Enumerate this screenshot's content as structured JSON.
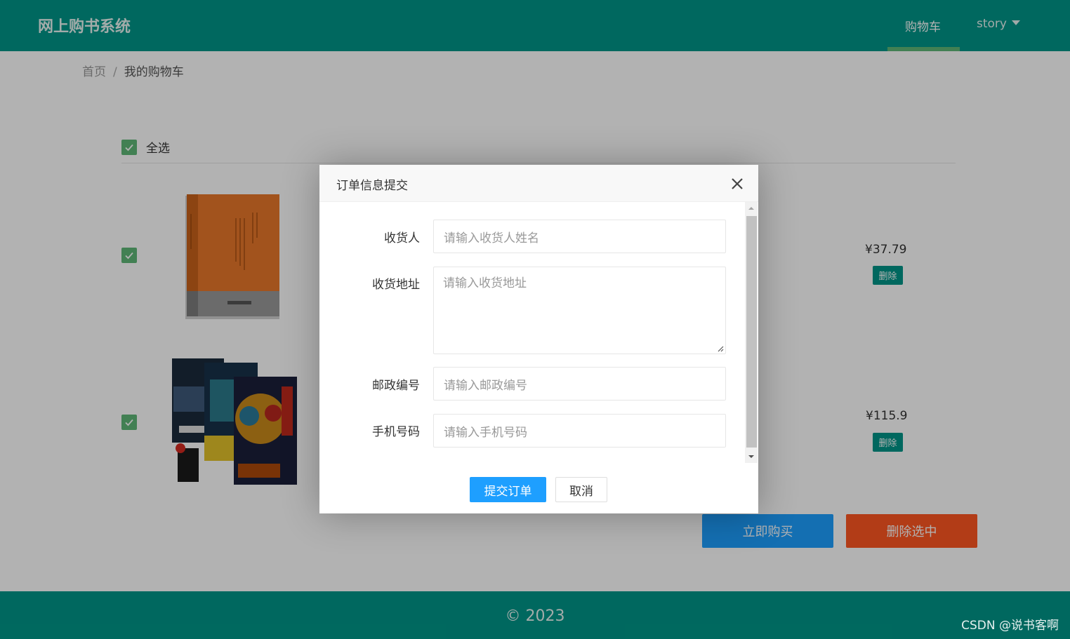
{
  "header": {
    "logo": "网上购书系统",
    "nav_cart": "购物车",
    "nav_user": "story"
  },
  "breadcrumb": {
    "home": "首页",
    "separator": "/",
    "current": "我的购物车"
  },
  "cart": {
    "select_all_label": "全选",
    "items": [
      {
        "price": "¥37.79",
        "delete_label": "删除",
        "checked": true
      },
      {
        "price": "¥115.9",
        "delete_label": "删除",
        "checked": true
      }
    ],
    "buy_label": "立即购买",
    "delete_selected_label": "删除选中"
  },
  "footer": {
    "text": "© 2023"
  },
  "watermark": "CSDN @说书客啊",
  "dialog": {
    "title": "订单信息提交",
    "fields": [
      {
        "label": "收货人",
        "placeholder": "请输入收货人姓名"
      },
      {
        "label": "收货地址",
        "placeholder": "请输入收货地址"
      },
      {
        "label": "邮政编号",
        "placeholder": "请输入邮政编号"
      },
      {
        "label": "手机号码",
        "placeholder": "请输入手机号码"
      }
    ],
    "submit_label": "提交订单",
    "cancel_label": "取消"
  },
  "colors": {
    "primary": "#009688",
    "accent_blue": "#1E9FFF",
    "danger": "#FF5722",
    "check_green": "#5FB878"
  },
  "icons": {
    "close": "close-icon",
    "checkbox": "check-icon",
    "nav_dropdown": "caret-down-icon"
  }
}
